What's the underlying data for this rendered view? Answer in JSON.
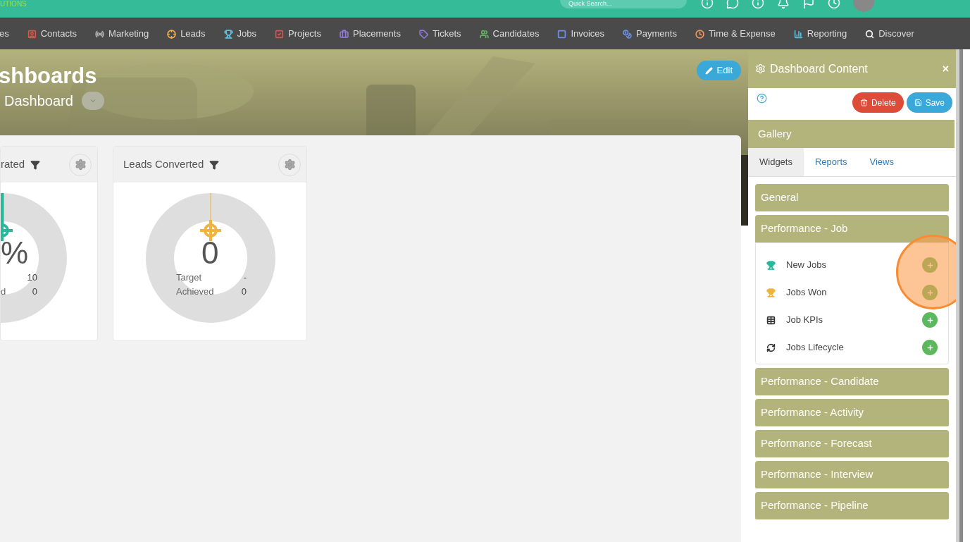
{
  "logo": {
    "text": "UTIONS"
  },
  "search": {
    "placeholder": "Quick Search..."
  },
  "nav": [
    {
      "label": "es"
    },
    {
      "label": "Contacts",
      "color": "#e0524a"
    },
    {
      "label": "Marketing",
      "color": "#b0b0b0"
    },
    {
      "label": "Leads",
      "color": "#f0ad4e"
    },
    {
      "label": "Jobs",
      "color": "#5bc0de"
    },
    {
      "label": "Projects",
      "color": "#e0524a"
    },
    {
      "label": "Placements",
      "color": "#8e7cd8"
    },
    {
      "label": "Tickets",
      "color": "#8e7cd8"
    },
    {
      "label": "Candidates",
      "color": "#5cb85c"
    },
    {
      "label": "Invoices",
      "color": "#6f8fe8"
    },
    {
      "label": "Payments",
      "color": "#6f8fe8"
    },
    {
      "label": "Time & Expense",
      "color": "#f0965a"
    },
    {
      "label": "Reporting",
      "color": "#5bc0de"
    },
    {
      "label": "Discover",
      "color": "#ffffff"
    }
  ],
  "hero": {
    "title": "shboards",
    "subtitle": "Dashboard",
    "edit": "Edit"
  },
  "cards": [
    {
      "title": "rated",
      "value": "%",
      "color": "#26b99a",
      "rows": [
        {
          "value": "10"
        },
        {
          "label": "d",
          "value": "0"
        }
      ]
    },
    {
      "title": "Leads Converted",
      "value": "0",
      "color": "#f0b43c",
      "rows": [
        {
          "label": "Target",
          "value": "-"
        },
        {
          "label": "Achieved",
          "value": "0"
        }
      ]
    }
  ],
  "panel": {
    "title": "Dashboard Content",
    "close": "×",
    "delete": "Delete",
    "save": "Save",
    "gallery": "Gallery",
    "tabs": [
      {
        "label": "Widgets",
        "selected": true
      },
      {
        "label": "Reports",
        "selected": false
      },
      {
        "label": "Views",
        "selected": false
      }
    ],
    "sections": [
      {
        "title": "General",
        "expanded": false
      },
      {
        "title": "Performance - Job",
        "expanded": true,
        "items": [
          {
            "label": "New Jobs",
            "color": "#26b99a"
          },
          {
            "label": "Jobs Won",
            "color": "#f0b43c"
          },
          {
            "label": "Job KPIs",
            "color": "#333333"
          },
          {
            "label": "Jobs Lifecycle",
            "color": "#333333"
          }
        ]
      },
      {
        "title": "Performance - Candidate",
        "expanded": false
      },
      {
        "title": "Performance - Activity",
        "expanded": false
      },
      {
        "title": "Performance - Forecast",
        "expanded": false
      },
      {
        "title": "Performance - Interview",
        "expanded": false
      },
      {
        "title": "Performance - Pipeline",
        "expanded": false
      }
    ]
  }
}
